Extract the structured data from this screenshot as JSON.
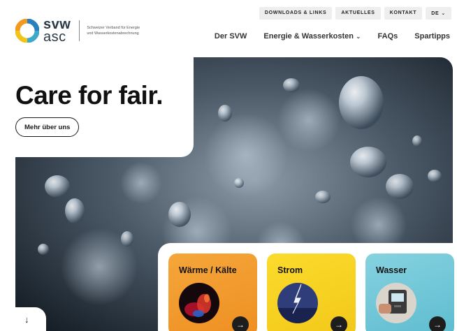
{
  "brand": {
    "name_top": "svw",
    "name_bottom": "asc",
    "tagline": "Schweizer Verband für Energie und Wasserkostenabrechnung",
    "ring_colors": [
      "#f39a1e",
      "#f2c318",
      "#3fa9c9",
      "#2a7fbd"
    ]
  },
  "utility_nav": {
    "downloads": "DOWNLOADS & LINKS",
    "news": "AKTUELLES",
    "contact": "KONTAKT",
    "language": "DE"
  },
  "main_nav": [
    {
      "label": "Der SVW"
    },
    {
      "label": "Energie & Wasserkosten",
      "has_dropdown": true
    },
    {
      "label": "FAQs"
    },
    {
      "label": "Spartipps"
    }
  ],
  "hero": {
    "title": "Care for fair.",
    "cta": "Mehr über uns",
    "scroll_hint_icon": "arrow-down-icon"
  },
  "cards": [
    {
      "label": "Wärme / Kälte",
      "color": "#f29a2e",
      "image": "fire-image"
    },
    {
      "label": "Strom",
      "color": "#f6d21e",
      "image": "lightning-image"
    },
    {
      "label": "Wasser",
      "color": "#72c7d8",
      "image": "water-tap-image"
    }
  ]
}
